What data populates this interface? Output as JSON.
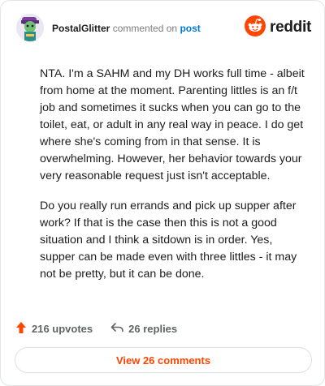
{
  "header": {
    "username": "PostalGlitter",
    "commented_text": "commented on",
    "post_link": "post",
    "brand": "reddit"
  },
  "comment": {
    "paragraphs": [
      "NTA. I'm a SAHM and my DH works full time - albeit from home at the moment. Parenting littles is an f/t job and sometimes it sucks when you can go to the toilet, eat, or adult in any real way in peace. I do get where she's coming from in that sense. It is overwhelming. However, her behavior towards your very reasonable request just isn't acceptable.",
      "Do you really run errands and pick up supper after work? If that is the case then this is not a good situation and I think a sitdown is in order. Yes, supper can be made even with three littles - it may not be pretty, but it can be done."
    ]
  },
  "actions": {
    "upvotes": "216 upvotes",
    "replies": "26 replies"
  },
  "footer": {
    "view_comments": "View 26 comments"
  },
  "colors": {
    "brand": "#ff4500",
    "link": "#0079d3",
    "muted": "#616466"
  },
  "icons": [
    "avatar",
    "reddit-logo-icon",
    "upvote-arrow-icon",
    "reply-arrow-icon"
  ]
}
